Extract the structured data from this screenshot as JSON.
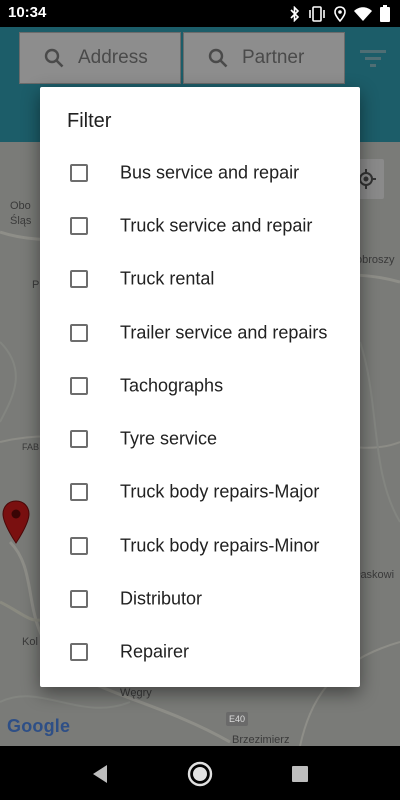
{
  "status_bar": {
    "time": "10:34",
    "icons": [
      "bluetooth-icon",
      "vibrate-icon",
      "location-icon",
      "wifi-icon",
      "battery-icon"
    ]
  },
  "header": {
    "address_label": "Address",
    "partner_label": "Partner",
    "colors": {
      "header_bg": "#1c5d69",
      "button_bg": "#8d8d8d"
    }
  },
  "map": {
    "labels": {
      "obo": "Obo",
      "slas": "Śląs",
      "p": "P",
      "fab": "FAB",
      "obroszy": "obroszy",
      "laskowi": "łaskowi",
      "kol": "Kol",
      "wegry": "Węgry",
      "brzezimierz": "Brzezimierz"
    },
    "road_shield": "E40",
    "google": "Google"
  },
  "dialog": {
    "title": "Filter",
    "options": [
      {
        "label": "Bus service and repair",
        "checked": false
      },
      {
        "label": "Truck service and repair",
        "checked": false
      },
      {
        "label": "Truck rental",
        "checked": false
      },
      {
        "label": "Trailer service and repairs",
        "checked": false
      },
      {
        "label": "Tachographs",
        "checked": false
      },
      {
        "label": "Tyre service",
        "checked": false
      },
      {
        "label": "Truck body repairs-Major",
        "checked": false
      },
      {
        "label": "Truck body repairs-Minor",
        "checked": false
      },
      {
        "label": "Distributor",
        "checked": false
      },
      {
        "label": "Repairer",
        "checked": false
      }
    ]
  },
  "nav_bar": {
    "buttons": [
      "back-icon",
      "home-icon",
      "recents-icon"
    ]
  }
}
